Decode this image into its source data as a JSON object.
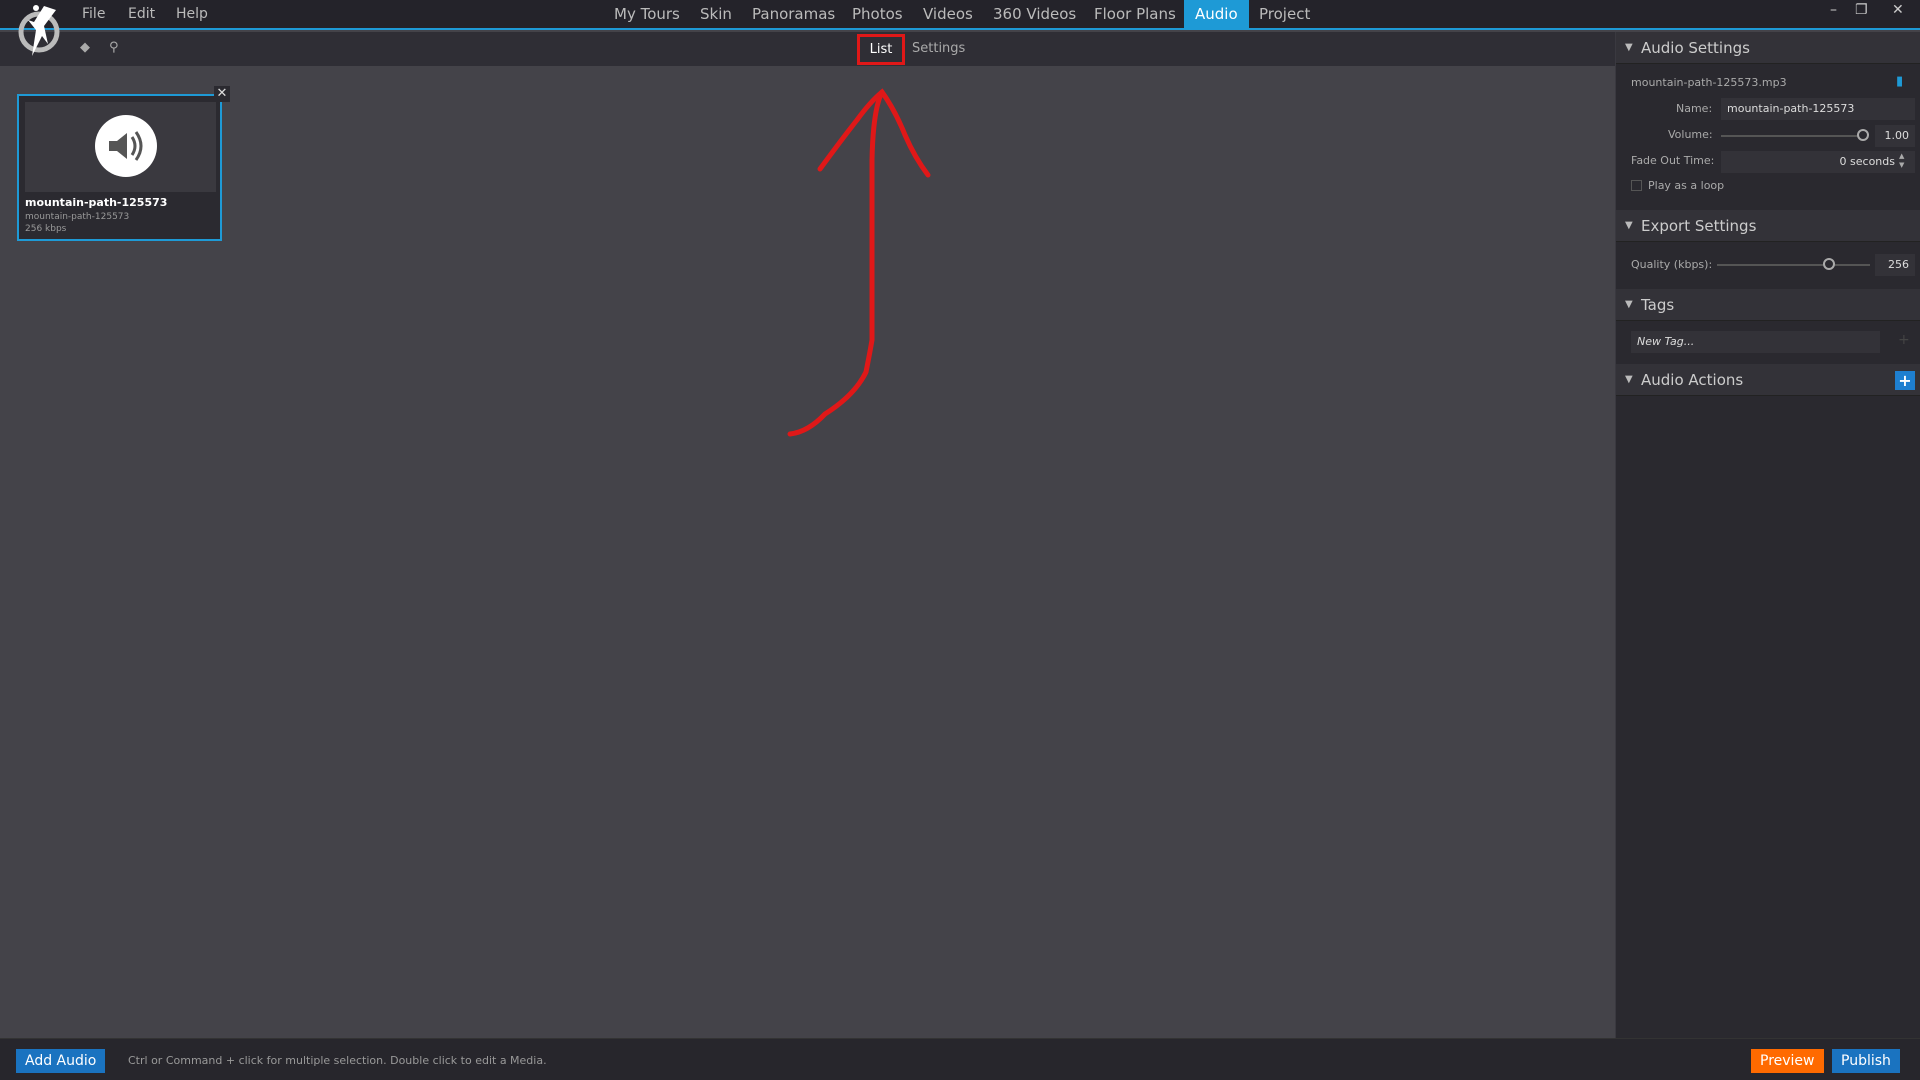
{
  "menu": [
    "File",
    "Edit",
    "Help"
  ],
  "nav": {
    "tabs": [
      "My Tours",
      "Skin",
      "Panoramas",
      "Photos",
      "Videos",
      "360 Videos",
      "Floor Plans",
      "Audio",
      "Project"
    ],
    "active": "Audio"
  },
  "view_tabs": {
    "list": "List",
    "settings": "Settings"
  },
  "card": {
    "title": "mountain-path-125573",
    "subtitle": "mountain-path-125573",
    "bitrate": "256 kbps"
  },
  "panel": {
    "audio_settings": {
      "header": "Audio Settings",
      "file": "mountain-path-125573.mp3",
      "name_label": "Name:",
      "name_value": "mountain-path-125573",
      "volume_label": "Volume:",
      "volume_value": "1.00",
      "fade_label": "Fade Out Time:",
      "fade_value": "0 seconds",
      "loop_label": "Play as a loop",
      "loop_checked": false
    },
    "export_settings": {
      "header": "Export Settings",
      "quality_label": "Quality (kbps):",
      "quality_value": "256"
    },
    "tags": {
      "header": "Tags",
      "placeholder": "New Tag..."
    },
    "audio_actions": {
      "header": "Audio Actions"
    }
  },
  "bottom": {
    "add_audio": "Add Audio",
    "hint": "Ctrl or Command + click for multiple selection. Double click to edit a Media.",
    "preview": "Preview",
    "publish": "Publish"
  },
  "colors": {
    "accent": "#1e9ad6",
    "preview": "#ff6a00",
    "annotation": "#e01818"
  }
}
